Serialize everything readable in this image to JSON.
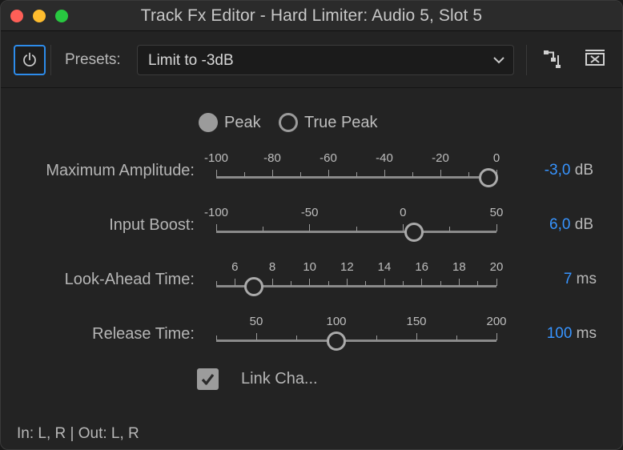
{
  "window": {
    "title": "Track Fx Editor - Hard Limiter: Audio 5, Slot 5"
  },
  "toolbar": {
    "power_icon": "power-icon",
    "presets_label": "Presets:",
    "preset_value": "Limit to -3dB",
    "routing_icon": "routing-icon",
    "close_icon": "close-panel-icon"
  },
  "mode": {
    "peak_label": "Peak",
    "true_peak_label": "True Peak",
    "selected": "Peak"
  },
  "params": [
    {
      "label": "Maximum Amplitude:",
      "scale": [
        "-100",
        "-80",
        "-60",
        "-40",
        "-20",
        "0"
      ],
      "min": -100,
      "max": 0,
      "value": -3,
      "value_text": "-3,0",
      "unit": "dB"
    },
    {
      "label": "Input Boost:",
      "scale": [
        "-100",
        "-50",
        "0",
        "50"
      ],
      "min": -100,
      "max": 50,
      "value": 6,
      "value_text": "6,0",
      "unit": "dB"
    },
    {
      "label": "Look-Ahead Time:",
      "scale": [
        "6",
        "8",
        "10",
        "12",
        "14",
        "16",
        "18",
        "20"
      ],
      "min": 5,
      "max": 20,
      "value": 7,
      "value_text": "7",
      "unit": "ms"
    },
    {
      "label": "Release Time:",
      "scale": [
        "50",
        "100",
        "150",
        "200"
      ],
      "min": 25,
      "max": 200,
      "value": 100,
      "value_text": "100",
      "unit": "ms"
    }
  ],
  "link_channels": {
    "label": "Link Cha...",
    "checked": true
  },
  "status": "In: L, R | Out: L, R",
  "colors": {
    "accent": "#3794ff",
    "power_border": "#2d8ceb"
  }
}
